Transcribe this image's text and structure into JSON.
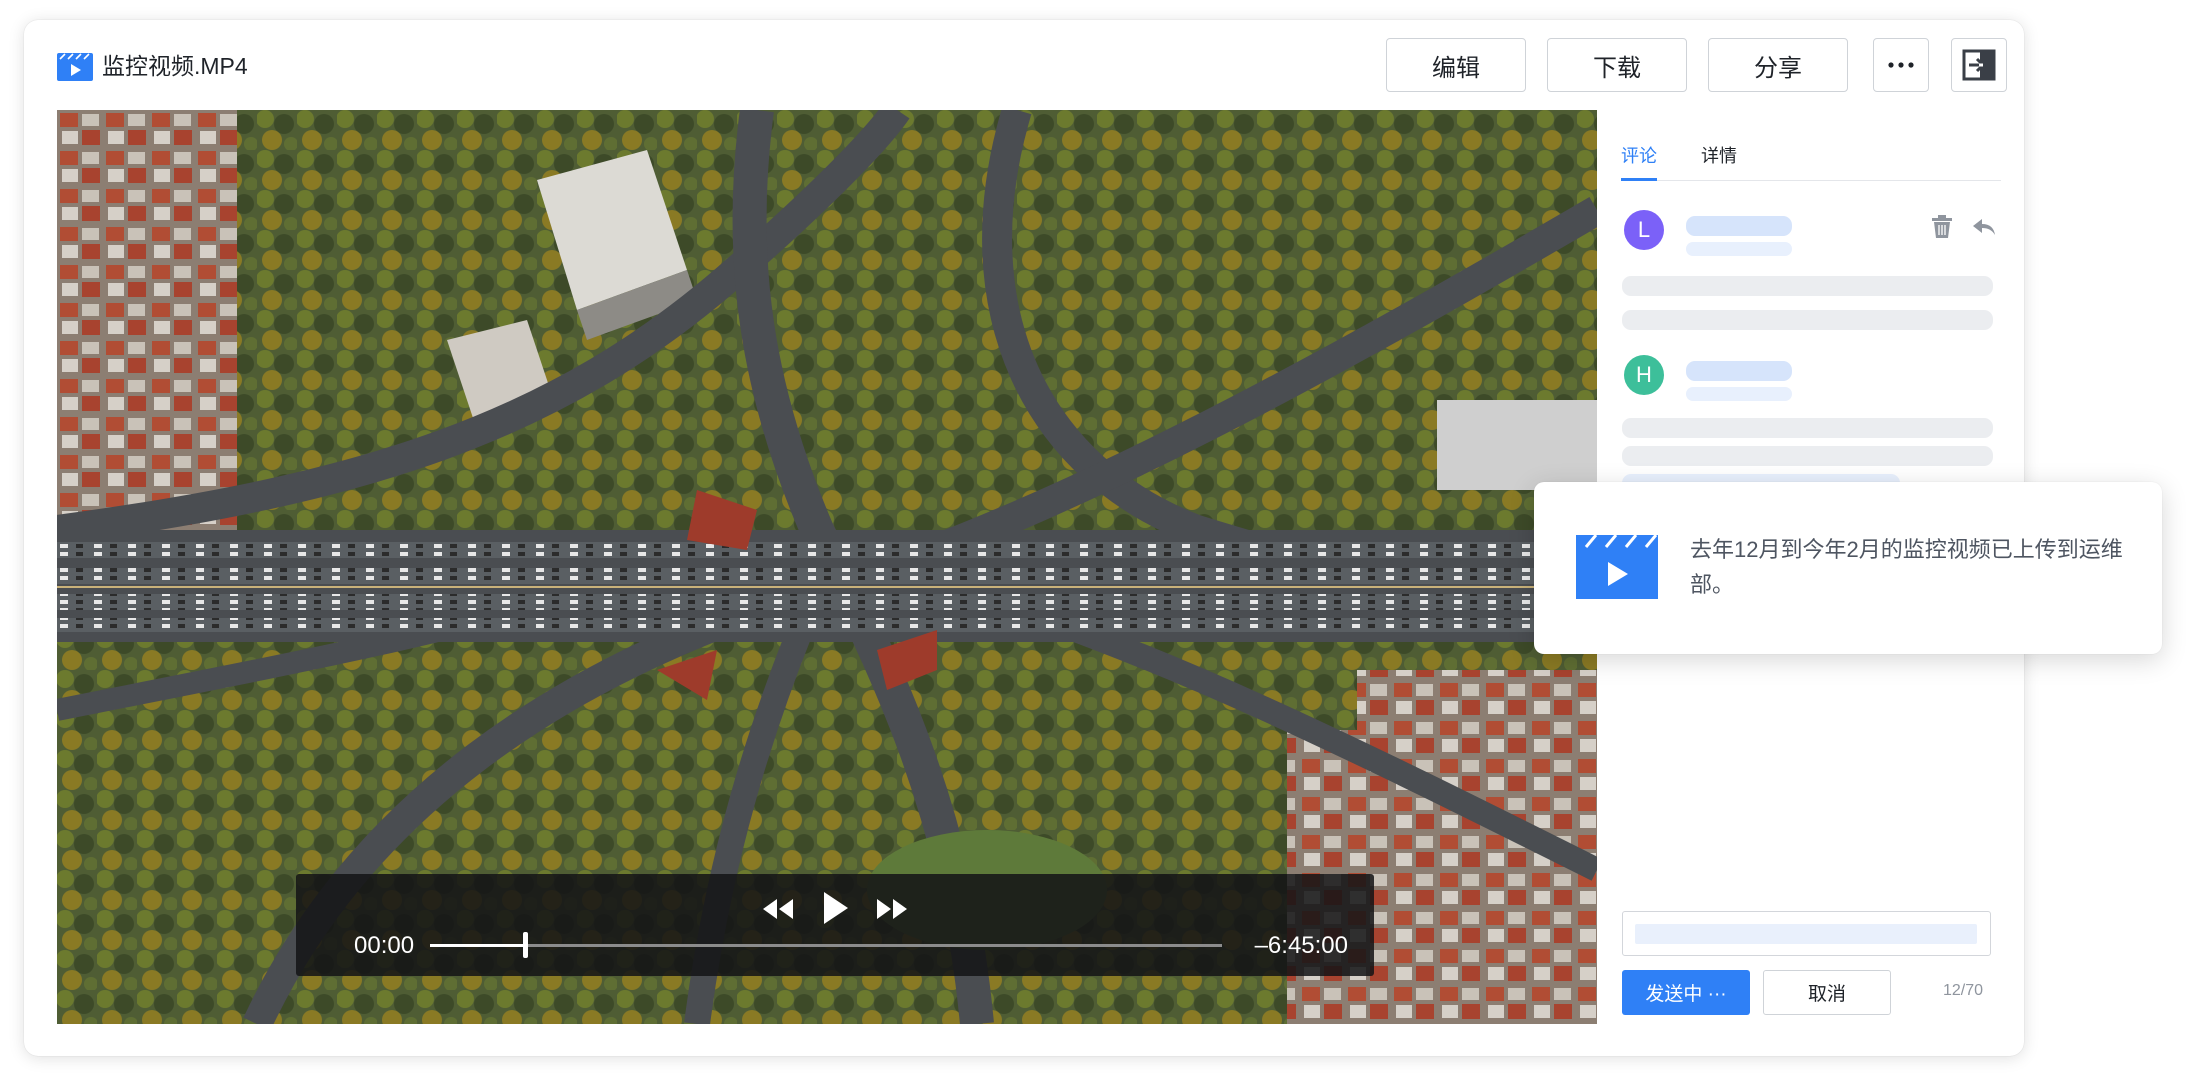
{
  "file": {
    "icon": "video-file-icon",
    "name": "监控视频.MP4"
  },
  "toolbar": {
    "edit_label": "编辑",
    "download_label": "下载",
    "share_label": "分享",
    "more_icon": "more-dots-icon",
    "exit_icon": "exit-panel-icon"
  },
  "player": {
    "current_time": "00:00",
    "remaining_time": "–6:45:00",
    "progress": 0.12,
    "rewind_icon": "rewind-icon",
    "play_icon": "play-icon",
    "forward_icon": "fast-forward-icon"
  },
  "side_panel": {
    "tabs": [
      {
        "label": "评论",
        "active": true
      },
      {
        "label": "详情",
        "active": false
      }
    ],
    "comments": [
      {
        "avatar_letter": "L",
        "avatar_color": "#7b61f8"
      },
      {
        "avatar_letter": "H",
        "avatar_color": "#3dbf9a"
      }
    ],
    "send_label": "发送中 ···",
    "cancel_label": "取消",
    "char_counter": "12/70"
  },
  "toast": {
    "icon": "video-clapper-icon",
    "message": "去年12月到今年2月的监控视频已上传到运维部。"
  },
  "colors": {
    "accent": "#2f80f6",
    "text": "#1f2329",
    "muted": "#8f959e"
  }
}
